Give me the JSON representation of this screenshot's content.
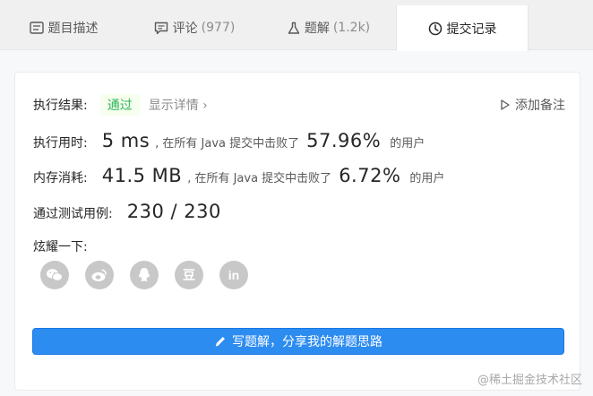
{
  "tabs": [
    {
      "label": "题目描述",
      "count": "",
      "icon": "description-icon"
    },
    {
      "label": "评论",
      "count": "(977)",
      "icon": "comment-icon"
    },
    {
      "label": "题解",
      "count": "(1.2k)",
      "icon": "flask-icon"
    },
    {
      "label": "提交记录",
      "count": "",
      "icon": "clock-icon"
    }
  ],
  "result": {
    "label": "执行结果:",
    "status": "通过",
    "detail_link": "显示详情 ›",
    "note_button": "添加备注"
  },
  "runtime": {
    "label": "执行用时:",
    "value": "5 ms",
    "mid_text": ", 在所有 Java 提交中击败了",
    "percent": "57.96%",
    "suffix": "的用户"
  },
  "memory": {
    "label": "内存消耗:",
    "value": "41.5 MB",
    "mid_text": ", 在所有 Java 提交中击败了",
    "percent": "6.72%",
    "suffix": "的用户"
  },
  "tests": {
    "label": "通过测试用例:",
    "value": "230 / 230"
  },
  "share": {
    "label": "炫耀一下:",
    "buttons": [
      "wechat-icon",
      "weibo-icon",
      "qq-icon",
      "douban-icon",
      "linkedin-icon"
    ],
    "douban_glyph": "豆",
    "linkedin_glyph": "in"
  },
  "write_button": "写题解，分享我的解题思路",
  "watermark": "@稀土掘金技术社区",
  "colors": {
    "accent": "#2d8cf0",
    "pass_green": "#2db55d"
  }
}
